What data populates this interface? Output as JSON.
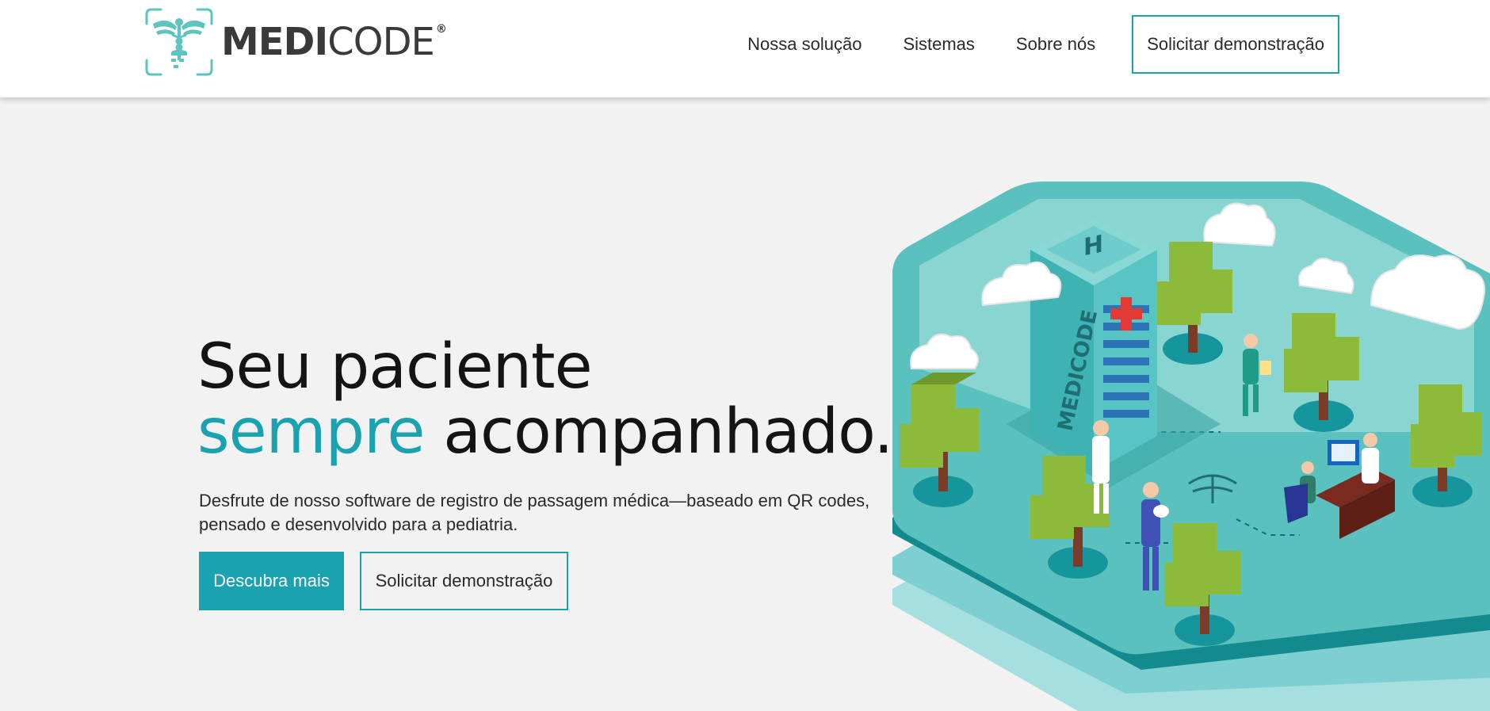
{
  "header": {
    "logo": {
      "bold": "MEDI",
      "light": "CODE",
      "reg": "®"
    },
    "nav": [
      {
        "label": "Nossa solução"
      },
      {
        "label": "Sistemas"
      },
      {
        "label": "Sobre nós"
      }
    ],
    "demo_label": "Solicitar demonstração"
  },
  "hero": {
    "title_line1": "Seu paciente",
    "title_accent": "sempre",
    "title_rest": " acompanhado.",
    "description": "Desfrute de nosso software de registro de passagem médica—baseado em QR codes, pensado e desenvolvido para a pediatria.",
    "primary_label": "Descubra mais",
    "secondary_label": "Solicitar demonstração"
  },
  "illustration": {
    "hospital_sign": "H",
    "building_text": "MEDICODE"
  },
  "colors": {
    "accent": "#1aa2b0",
    "background": "#f2f2f2",
    "tree_green": "#8cbb3a",
    "tree_trunk": "#7a3b27"
  }
}
